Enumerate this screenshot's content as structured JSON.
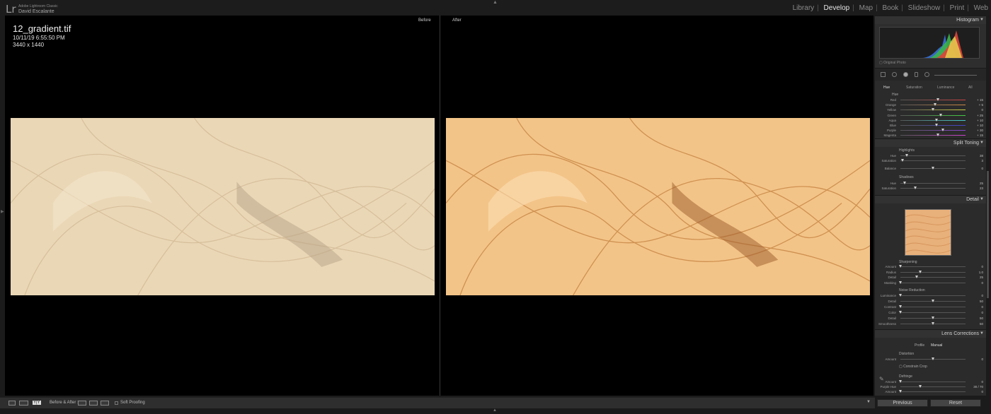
{
  "app": {
    "logo": "Lr",
    "name": "Adobe Lightroom Classic",
    "user": "David Escalante"
  },
  "modules": [
    "Library",
    "Develop",
    "Map",
    "Book",
    "Slideshow",
    "Print",
    "Web"
  ],
  "active_module": "Develop",
  "photo": {
    "filename": "12_gradient.tif",
    "datetime": "10/11/19 6:55:50 PM",
    "dimensions": "3440 x 1440"
  },
  "compare": {
    "before_label": "Before",
    "after_label": "After"
  },
  "panels": {
    "histogram": "Histogram",
    "original_photo": "Original Photo",
    "split_toning": "Split Toning",
    "detail": "Detail",
    "lens_corrections": "Lens Corrections"
  },
  "hsl": {
    "tabs": [
      "Hue",
      "Saturation",
      "Luminance",
      "All"
    ],
    "section": "Hue",
    "rows": [
      {
        "label": "Red",
        "value": "+ 15",
        "level": 0.58,
        "color": "#c44"
      },
      {
        "label": "Orange",
        "value": "+ 5",
        "level": 0.53,
        "color": "#c84"
      },
      {
        "label": "Yellow",
        "value": "0",
        "level": 0.5,
        "color": "#cc4"
      },
      {
        "label": "Green",
        "value": "+ 25",
        "level": 0.62,
        "color": "#4c4"
      },
      {
        "label": "Aqua",
        "value": "+ 10",
        "level": 0.55,
        "color": "#4cc"
      },
      {
        "label": "Blue",
        "value": "+ 10",
        "level": 0.55,
        "color": "#44c"
      },
      {
        "label": "Purple",
        "value": "+ 30",
        "level": 0.65,
        "color": "#84c"
      },
      {
        "label": "Magenta",
        "value": "+ 15",
        "level": 0.58,
        "color": "#c4c"
      }
    ]
  },
  "split_toning": {
    "highlights": "Highlights",
    "shadows": "Shadows",
    "balance_label": "Balance",
    "balance_value": "0",
    "highlight_rows": [
      {
        "label": "Hue",
        "value": "38",
        "level": 0.1
      },
      {
        "label": "Saturation",
        "value": "3",
        "level": 0.03
      }
    ],
    "shadow_rows": [
      {
        "label": "Hue",
        "value": "25",
        "level": 0.07
      },
      {
        "label": "Saturation",
        "value": "23",
        "level": 0.23
      }
    ]
  },
  "detail": {
    "sharpening": "Sharpening",
    "sharpening_rows": [
      {
        "label": "Amount",
        "value": "0",
        "level": 0.0
      },
      {
        "label": "Radius",
        "value": "1.0",
        "level": 0.3
      },
      {
        "label": "Detail",
        "value": "25",
        "level": 0.25
      },
      {
        "label": "Masking",
        "value": "0",
        "level": 0.0
      }
    ],
    "noise": "Noise Reduction",
    "noise_rows": [
      {
        "label": "Luminance",
        "value": "0",
        "level": 0.0
      },
      {
        "label": "Detail",
        "value": "50",
        "level": 0.5
      },
      {
        "label": "Contrast",
        "value": "0",
        "level": 0.0
      },
      {
        "label": "Color",
        "value": "0",
        "level": 0.0
      },
      {
        "label": "Detail",
        "value": "50",
        "level": 0.5
      },
      {
        "label": "Smoothness",
        "value": "50",
        "level": 0.5
      }
    ]
  },
  "lens": {
    "tabs": [
      "Profile",
      "Manual"
    ],
    "distortion": "Distortion",
    "amount_label": "Amount",
    "amount_value": "0",
    "constrain_crop": "Constrain Crop",
    "defringe": "Defringe",
    "defringe_rows": [
      {
        "label": "Amount",
        "value": "0",
        "level": 0.0
      },
      {
        "label": "Purple Hue",
        "value": "30 / 70",
        "level": 0.3
      },
      {
        "label": "Amount",
        "value": "0",
        "level": 0.0
      }
    ]
  },
  "toolbar": {
    "view_mode": "Y|Y",
    "before_after": "Before & After :",
    "soft_proofing": "Soft Proofing"
  },
  "buttons": {
    "previous": "Previous",
    "reset": "Reset"
  }
}
